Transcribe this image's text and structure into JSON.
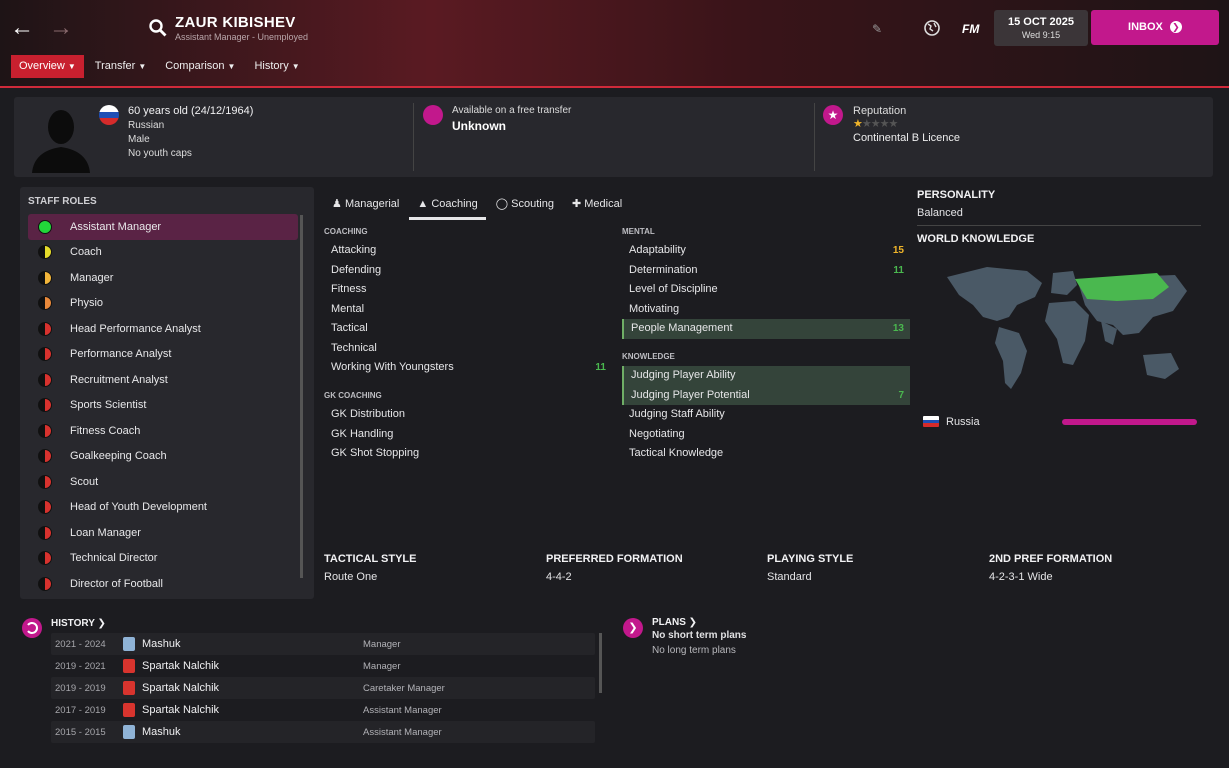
{
  "header": {
    "name": "ZAUR KIBISHEV",
    "subtitle": "Assistant Manager - Unemployed",
    "brand": "FM",
    "date": "15 OCT 2025",
    "time": "Wed 9:15",
    "inbox": "INBOX",
    "accent": "#c2188c"
  },
  "tabs": [
    "Overview",
    "Transfer",
    "Comparison",
    "History"
  ],
  "info": {
    "age": "60 years old (24/12/1964)",
    "nationality": "Russian",
    "gender": "Male",
    "caps": "No youth caps",
    "transfer_label": "Available on a free transfer",
    "transfer_value": "Unknown",
    "rep_label": "Reputation",
    "reputation_stars": 1,
    "licence": "Continental B Licence"
  },
  "staff_roles": {
    "title": "STAFF ROLES",
    "items": [
      {
        "label": "Assistant Manager",
        "color": "#22d63a"
      },
      {
        "label": "Coach",
        "color": "#e6dc2a"
      },
      {
        "label": "Manager",
        "color": "#f2b53a"
      },
      {
        "label": "Physio",
        "color": "#e8883a"
      },
      {
        "label": "Head Performance Analyst",
        "color": "#d8322e"
      },
      {
        "label": "Performance Analyst",
        "color": "#d8322e"
      },
      {
        "label": "Recruitment Analyst",
        "color": "#d8322e"
      },
      {
        "label": "Sports Scientist",
        "color": "#d8322e"
      },
      {
        "label": "Fitness Coach",
        "color": "#d8322e"
      },
      {
        "label": "Goalkeeping Coach",
        "color": "#d8322e"
      },
      {
        "label": "Scout",
        "color": "#d8322e"
      },
      {
        "label": "Head of Youth Development",
        "color": "#d8322e"
      },
      {
        "label": "Loan Manager",
        "color": "#d8322e"
      },
      {
        "label": "Technical Director",
        "color": "#d8322e"
      },
      {
        "label": "Director of Football",
        "color": "#d8322e"
      }
    ]
  },
  "attr_tabs": [
    "Managerial",
    "Coaching",
    "Scouting",
    "Medical"
  ],
  "coaching": {
    "title": "COACHING",
    "items": [
      {
        "label": "Attacking",
        "value": ""
      },
      {
        "label": "Defending",
        "value": ""
      },
      {
        "label": "Fitness",
        "value": ""
      },
      {
        "label": "Mental",
        "value": ""
      },
      {
        "label": "Tactical",
        "value": ""
      },
      {
        "label": "Technical",
        "value": ""
      },
      {
        "label": "Working With Youngsters",
        "value": "11"
      }
    ]
  },
  "gk": {
    "title": "GK COACHING",
    "items": [
      {
        "label": "GK Distribution",
        "value": ""
      },
      {
        "label": "GK Handling",
        "value": ""
      },
      {
        "label": "GK Shot Stopping",
        "value": ""
      }
    ]
  },
  "mental": {
    "title": "MENTAL",
    "items": [
      {
        "label": "Adaptability",
        "value": "15"
      },
      {
        "label": "Determination",
        "value": "11"
      },
      {
        "label": "Level of Discipline",
        "value": ""
      },
      {
        "label": "Motivating",
        "value": ""
      },
      {
        "label": "People Management",
        "value": "13"
      }
    ]
  },
  "knowledge": {
    "title": "KNOWLEDGE",
    "items": [
      {
        "label": "Judging Player Ability",
        "value": ""
      },
      {
        "label": "Judging Player Potential",
        "value": "7"
      },
      {
        "label": "Judging Staff Ability",
        "value": ""
      },
      {
        "label": "Negotiating",
        "value": ""
      },
      {
        "label": "Tactical Knowledge",
        "value": ""
      }
    ]
  },
  "personality": {
    "title": "PERSONALITY",
    "value": "Balanced"
  },
  "world": {
    "title": "WORLD KNOWLEDGE",
    "country": "Russia",
    "level": 0.9
  },
  "style": [
    {
      "label": "TACTICAL STYLE",
      "value": "Route One"
    },
    {
      "label": "PREFERRED FORMATION",
      "value": "4-4-2"
    },
    {
      "label": "PLAYING STYLE",
      "value": "Standard"
    },
    {
      "label": "2ND PREF FORMATION",
      "value": "4-2-3-1 Wide"
    }
  ],
  "history": {
    "title": "HISTORY",
    "rows": [
      {
        "years": "2021 - 2024",
        "club": "Mashuk",
        "role": "Manager",
        "badge": "blue"
      },
      {
        "years": "2019 - 2021",
        "club": "Spartak Nalchik",
        "role": "Manager",
        "badge": "red"
      },
      {
        "years": "2019 - 2019",
        "club": "Spartak Nalchik",
        "role": "Caretaker Manager",
        "badge": "red"
      },
      {
        "years": "2017 - 2019",
        "club": "Spartak Nalchik",
        "role": "Assistant Manager",
        "badge": "red"
      },
      {
        "years": "2015 - 2015",
        "club": "Mashuk",
        "role": "Assistant Manager",
        "badge": "blue"
      }
    ]
  },
  "plans": {
    "title": "PLANS",
    "short": "No short term plans",
    "long": "No long term plans"
  }
}
